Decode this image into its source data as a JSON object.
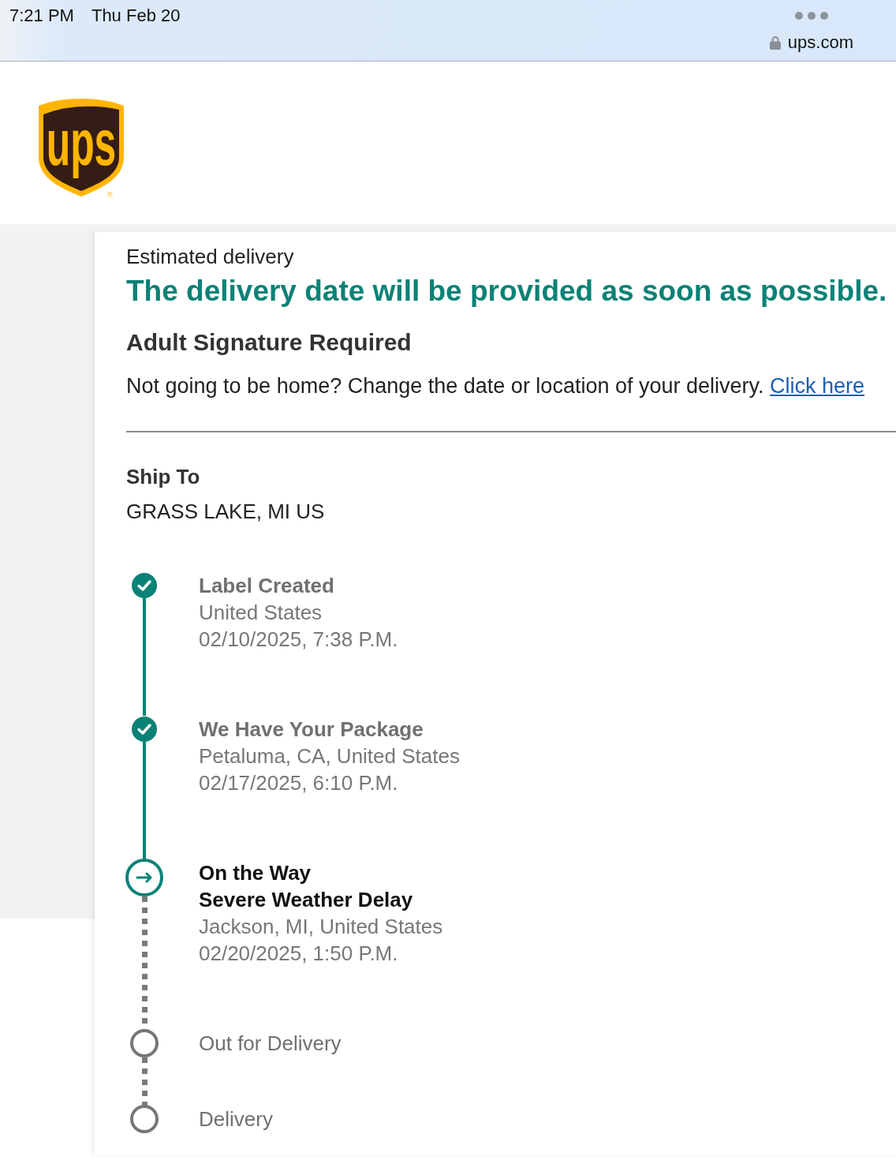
{
  "status_bar": {
    "time": "7:21 PM",
    "date": "Thu Feb 20",
    "url": "ups.com"
  },
  "header": {
    "logo_text": "ups",
    "logo_mark": "®"
  },
  "delivery": {
    "label": "Estimated delivery",
    "headline": "The delivery date will be provided as soon as possible.",
    "notice": "Adult Signature Required",
    "message": "Not going to be home? Change the date or location of your delivery.",
    "link": "Click here"
  },
  "ship_to": {
    "heading": "Ship To",
    "address": "GRASS LAKE, MI US"
  },
  "progress": [
    {
      "completed": true,
      "current": false,
      "title": "Label Created",
      "details": [
        "United States",
        "02/10/2025, 7:38 P.M."
      ]
    },
    {
      "completed": true,
      "current": false,
      "title": "We Have Your Package",
      "details": [
        "Petaluma, CA, United States",
        "02/17/2025, 6:10 P.M."
      ]
    },
    {
      "completed": false,
      "current": true,
      "title": "On the Way",
      "subtitle": "Severe Weather Delay",
      "details": [
        "Jackson, MI, United States",
        "02/20/2025, 1:50 P.M."
      ]
    },
    {
      "completed": false,
      "current": false,
      "title": "Out for Delivery"
    },
    {
      "completed": false,
      "current": false,
      "title": "Delivery"
    }
  ]
}
